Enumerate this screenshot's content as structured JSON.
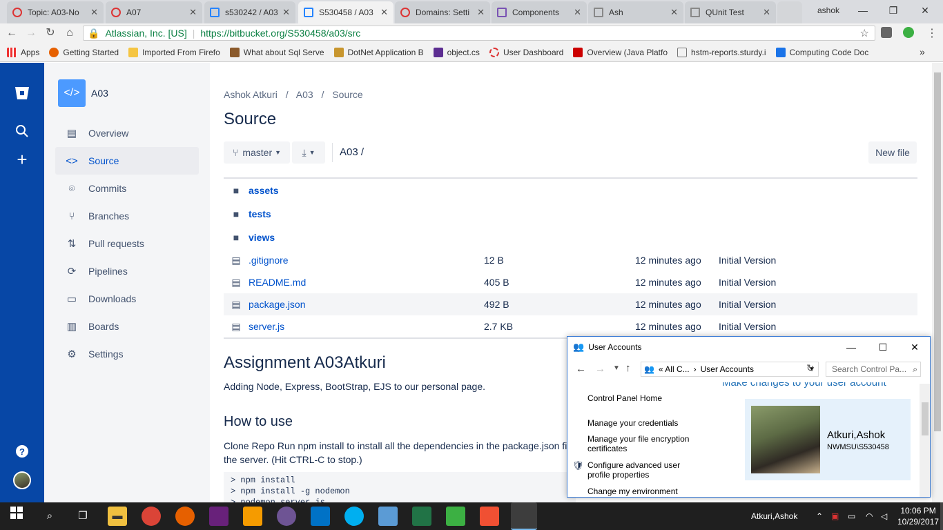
{
  "browser": {
    "tabs": [
      {
        "title": "Topic: A03-No",
        "active": false
      },
      {
        "title": "A07",
        "active": false
      },
      {
        "title": "s530242 / A03",
        "active": false
      },
      {
        "title": "S530458 / A03",
        "active": true
      },
      {
        "title": "Domains: Setti",
        "active": false
      },
      {
        "title": "Components",
        "active": false
      },
      {
        "title": "Ash",
        "active": false
      },
      {
        "title": "QUnit Test",
        "active": false
      }
    ],
    "profile": "ashok",
    "identity": "Atlassian, Inc. [US]",
    "url_host": "https://bitbucket.org",
    "url_path": "/S530458/a03/src",
    "bookmarks": [
      "Apps",
      "Getting Started",
      "Imported From Firefo",
      "What about Sql Serve",
      "DotNet Application B",
      "object.cs",
      "User Dashboard",
      "Overview (Java Platfo",
      "hstm-reports.sturdy.i",
      "Computing Code Doc"
    ],
    "bookmark_more": "»"
  },
  "repo": {
    "name": "A03",
    "nav": [
      {
        "label": "Overview",
        "icon": "overview-icon",
        "glyph": "▤"
      },
      {
        "label": "Source",
        "icon": "code-icon",
        "glyph": "<>"
      },
      {
        "label": "Commits",
        "icon": "commit-icon",
        "glyph": "⌾"
      },
      {
        "label": "Branches",
        "icon": "branch-icon",
        "glyph": "⑂"
      },
      {
        "label": "Pull requests",
        "icon": "pull-request-icon",
        "glyph": "⇅"
      },
      {
        "label": "Pipelines",
        "icon": "pipelines-icon",
        "glyph": "⟳"
      },
      {
        "label": "Downloads",
        "icon": "downloads-icon",
        "glyph": "▭"
      },
      {
        "label": "Boards",
        "icon": "boards-icon",
        "glyph": "▥"
      },
      {
        "label": "Settings",
        "icon": "settings-icon",
        "glyph": "⚙"
      }
    ]
  },
  "source": {
    "breadcrumb": [
      "Ashok Atkuri",
      "A03",
      "Source"
    ],
    "title": "Source",
    "branch": "master",
    "path": "A03 /",
    "new_file": "New file",
    "files": [
      {
        "name": "assets",
        "type": "folder",
        "size": "",
        "time": "",
        "commit": ""
      },
      {
        "name": "tests",
        "type": "folder",
        "size": "",
        "time": "",
        "commit": ""
      },
      {
        "name": "views",
        "type": "folder",
        "size": "",
        "time": "",
        "commit": ""
      },
      {
        "name": ".gitignore",
        "type": "file",
        "size": "12 B",
        "time": "12 minutes ago",
        "commit": "Initial Version"
      },
      {
        "name": "README.md",
        "type": "file",
        "size": "405 B",
        "time": "12 minutes ago",
        "commit": "Initial Version"
      },
      {
        "name": "package.json",
        "type": "file",
        "size": "492 B",
        "time": "12 minutes ago",
        "commit": "Initial Version"
      },
      {
        "name": "server.js",
        "type": "file",
        "size": "2.7 KB",
        "time": "12 minutes ago",
        "commit": "Initial Version"
      }
    ]
  },
  "readme": {
    "title": "Assignment A03Atkuri",
    "intro": "Adding Node, Express, BootStrap, EJS to our personal page.",
    "how_title": "How to use",
    "how_text": "Clone Repo Run npm install to install all the dependencies in the package.json file the server. (Hit CTRL-C to stop.)",
    "code_lines": [
      "> npm install",
      "> npm install -g nodemon",
      "> nodemon server.js"
    ]
  },
  "dialog": {
    "title": "User Accounts",
    "path_prefix": "«  All C...",
    "path_current": "User Accounts",
    "search_placeholder": "Search Control Pa...",
    "heading": "Make changes to your user account",
    "links": [
      "Control Panel Home",
      "Manage your credentials",
      "Manage your file encryption certificates",
      "Configure advanced user profile properties",
      "Change my environment"
    ],
    "user_name": "Atkuri,Ashok",
    "user_id": "NWMSU\\S530458"
  },
  "taskbar": {
    "user": "Atkuri,Ashok",
    "time": "10:06 PM",
    "date": "10/29/2017"
  }
}
